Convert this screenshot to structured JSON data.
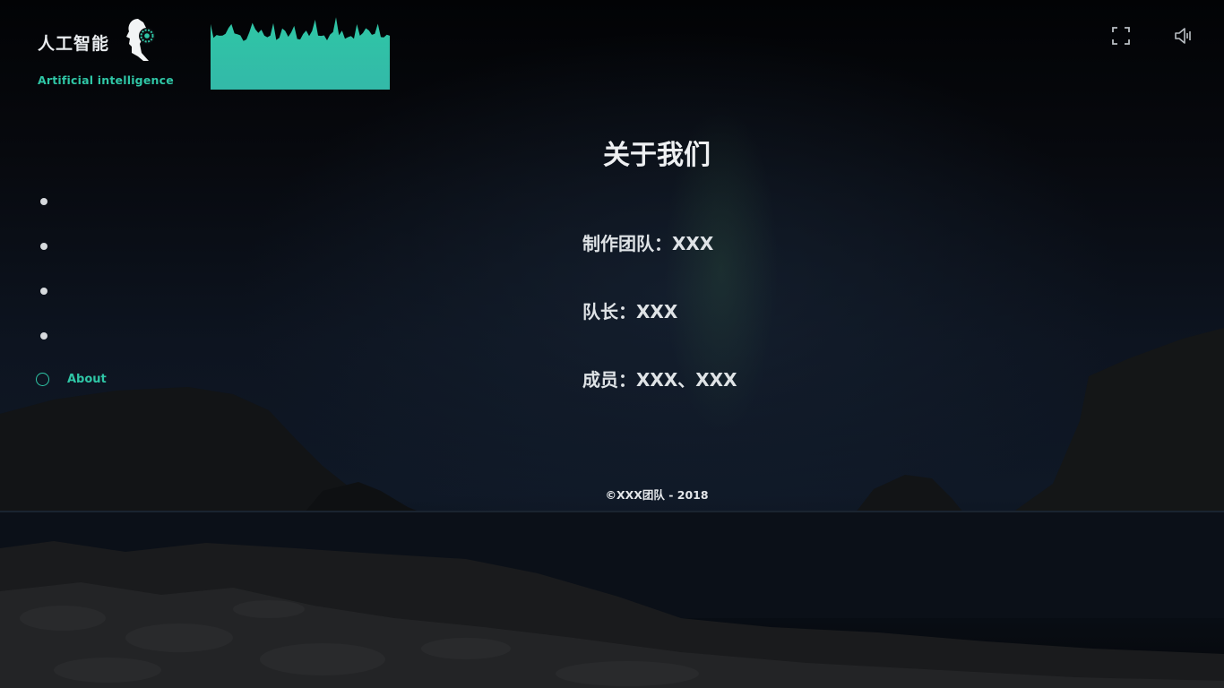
{
  "header": {
    "logo_title": "人工智能",
    "logo_subtitle": "Artificial intelligence",
    "icons": [
      "face-logo-icon",
      "audio-visualizer",
      "fullscreen-icon",
      "volume-icon"
    ]
  },
  "theme": {
    "accent": "#2fc6a6",
    "text": "#e4e7ea",
    "background": "#05070b"
  },
  "nav": {
    "items": [
      {
        "label": "",
        "active": false
      },
      {
        "label": "",
        "active": false
      },
      {
        "label": "",
        "active": false
      },
      {
        "label": "",
        "active": false
      },
      {
        "label": "About",
        "active": true
      }
    ]
  },
  "about": {
    "title": "关于我们",
    "team": "制作团队：XXX",
    "leader": "队长：XXX",
    "members": "成员：XXX、XXX"
  },
  "footer": {
    "copyright": "©XXX团队 - 2018"
  }
}
